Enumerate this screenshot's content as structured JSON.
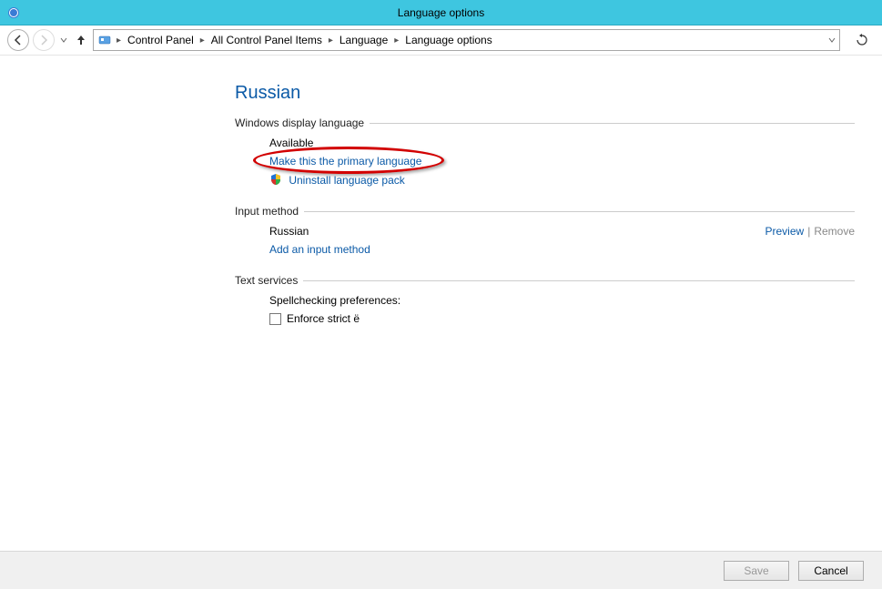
{
  "window": {
    "title": "Language options"
  },
  "breadcrumb": {
    "root_icon": "control-panel",
    "items": [
      "Control Panel",
      "All Control Panel Items",
      "Language",
      "Language options"
    ]
  },
  "page": {
    "heading": "Russian"
  },
  "display_language": {
    "section_label": "Windows display language",
    "status": "Available",
    "primary_link": "Make this the primary language",
    "uninstall_link": "Uninstall language pack"
  },
  "input_method": {
    "section_label": "Input method",
    "method_name": "Russian",
    "preview": "Preview",
    "remove": "Remove",
    "add_link": "Add an input method"
  },
  "text_services": {
    "section_label": "Text services",
    "spell_label": "Spellchecking preferences:",
    "enforce_label": "Enforce strict ё"
  },
  "buttons": {
    "save": "Save",
    "cancel": "Cancel"
  }
}
